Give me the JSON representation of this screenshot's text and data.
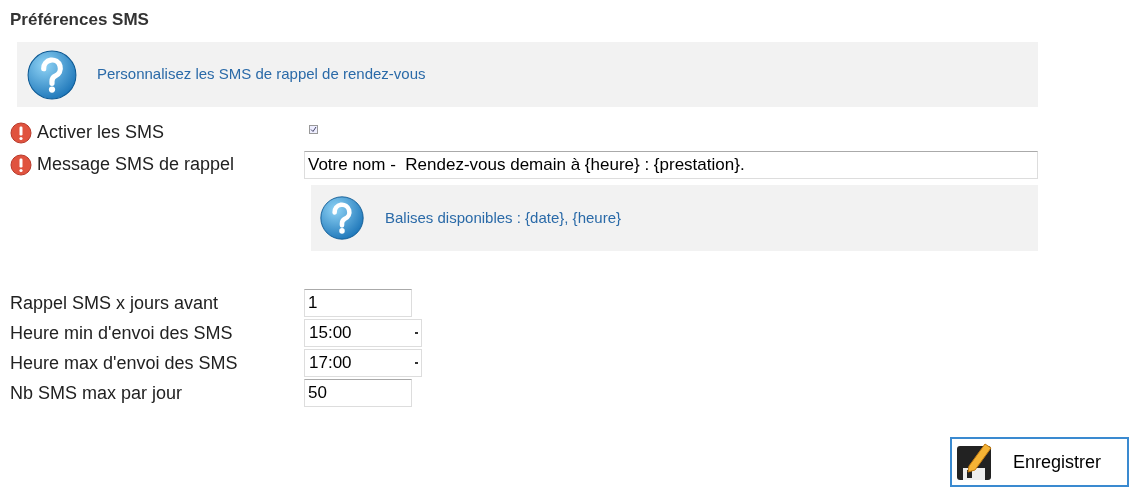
{
  "title": "Préférences SMS",
  "info": {
    "text": "Personnalisez les SMS de rappel de rendez-vous"
  },
  "fields": [
    {
      "kind": "checkbox",
      "label": "Activer les SMS",
      "required": true,
      "checked": true
    },
    {
      "kind": "text",
      "label": "Message SMS de rappel",
      "required": true,
      "value": "Votre nom -  Rendez-vous demain à {heure} : {prestation}.",
      "hint": "Balises disponibles : {date}, {heure}"
    }
  ],
  "settings": [
    {
      "kind": "text",
      "label": "Rappel SMS x jours avant",
      "value": "1"
    },
    {
      "kind": "select",
      "label": "Heure min d'envoi des SMS",
      "value": "15:00"
    },
    {
      "kind": "select",
      "label": "Heure max d'envoi des SMS",
      "value": "17:00"
    },
    {
      "kind": "text",
      "label": "Nb SMS max par jour",
      "value": "50"
    }
  ],
  "save_button": {
    "label": "Enregistrer"
  }
}
